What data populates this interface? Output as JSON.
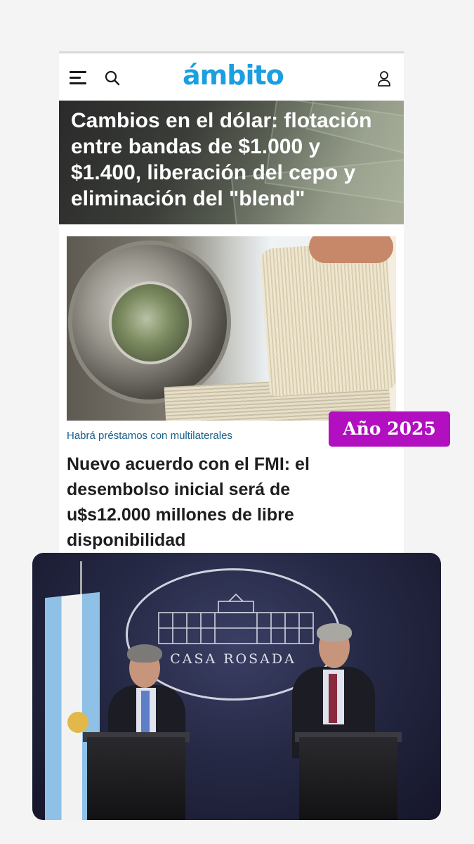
{
  "header": {
    "logo": "ámbito",
    "menu_icon": "hamburger-menu-icon",
    "search_icon": "search-icon",
    "user_icon": "user-account-icon"
  },
  "hero": {
    "title": "Cambios en el dólar: flotación entre bandas de $1.000 y $1.400, liberación del cepo y eliminación del \"blend\""
  },
  "article": {
    "kicker": "Habrá préstamos con multilaterales",
    "headline": "Nuevo acuerdo con el FMI: el desembolso inicial será de u$s12.000 millones de libre disponibilidad"
  },
  "badge": {
    "label": "Año 2025"
  },
  "video": {
    "backdrop_text": "CASA ROSADA"
  },
  "colors": {
    "brand": "#1b9fe0",
    "kicker": "#15608c",
    "badge": "#b10fbf"
  }
}
